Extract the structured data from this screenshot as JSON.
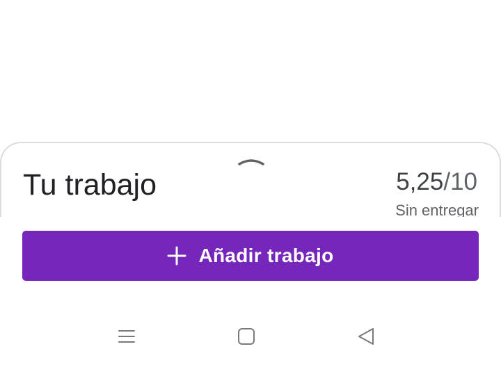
{
  "sheet": {
    "title": "Tu trabajo",
    "grade": {
      "points": "5,25",
      "total": "/10"
    },
    "status": "Sin entregar",
    "handle_icon": "chevron-up-icon"
  },
  "add_work_button": {
    "label": "Añadir trabajo",
    "icon": "plus-icon",
    "color": "#7627bb"
  },
  "system_nav": {
    "items": [
      "menu-icon",
      "home-square-icon",
      "back-triangle-icon"
    ]
  }
}
